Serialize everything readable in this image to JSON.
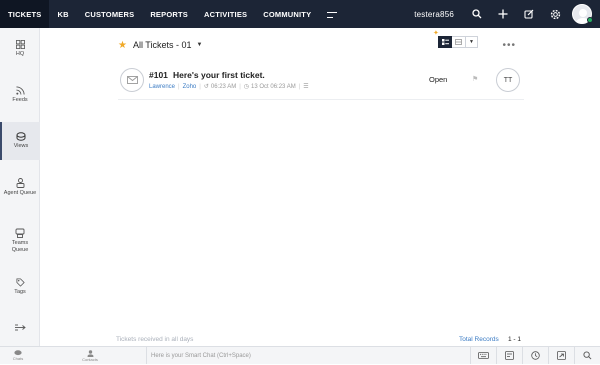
{
  "topbar": {
    "tabs": [
      {
        "label": "TICKETS",
        "active": true
      },
      {
        "label": "KB"
      },
      {
        "label": "CUSTOMERS"
      },
      {
        "label": "REPORTS"
      },
      {
        "label": "ACTIVITIES"
      },
      {
        "label": "COMMUNITY"
      }
    ],
    "portal": "testera856",
    "icons": [
      "search-icon",
      "plus-icon",
      "compose-icon",
      "settings-icon"
    ]
  },
  "sidebar": {
    "items": [
      {
        "label": "HQ",
        "icon": "grid-icon"
      },
      {
        "label": "Feeds",
        "icon": "rss-icon"
      },
      {
        "label": "Views",
        "icon": "views-icon",
        "active": true
      },
      {
        "label": "Agent Queue",
        "icon": "agent-queue-icon"
      },
      {
        "label": "Teams Queue",
        "icon": "teams-queue-icon"
      },
      {
        "label": "Tags",
        "icon": "tag-icon"
      }
    ]
  },
  "view": {
    "title": "All Tickets - 01"
  },
  "ticket": {
    "id": "#101",
    "subject": "Here's your first ticket.",
    "contact": "Lawrence",
    "account": "Zoho",
    "time": "06:23 AM",
    "date": "13 Oct 06:23 AM",
    "status": "Open",
    "assignee": "TT"
  },
  "footer": {
    "info": "Tickets received in all days",
    "records_label": "Total Records",
    "records_count": "1 - 1"
  },
  "bottombar": {
    "chats_label": "Chats",
    "contacts_label": "Contacts",
    "chat_placeholder": "Here is your Smart Chat (Ctrl+Space)"
  },
  "colors": {
    "topbar": "#1c2536",
    "accent": "#3c7cc4",
    "star": "#f0a928",
    "online": "#27ae60"
  }
}
